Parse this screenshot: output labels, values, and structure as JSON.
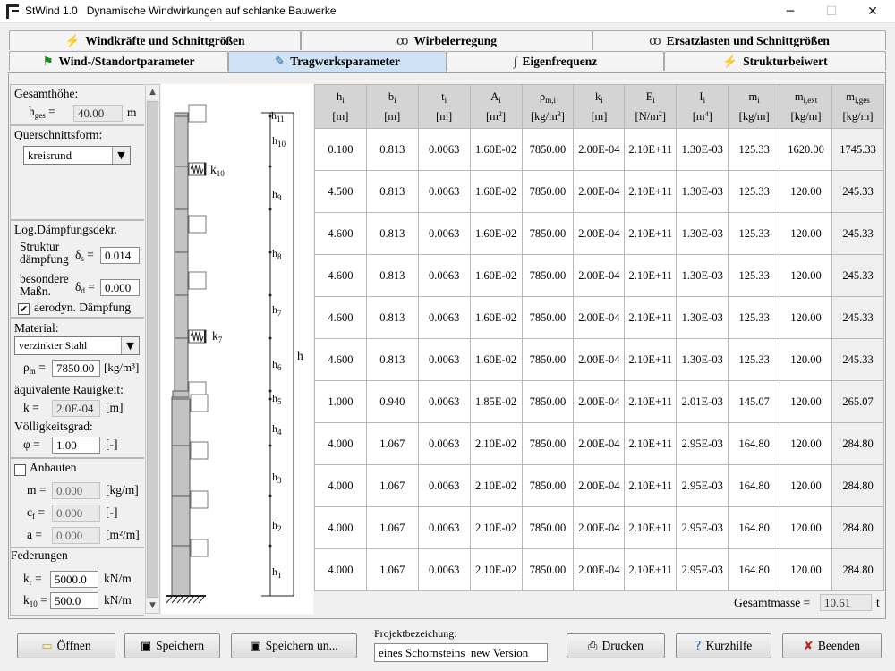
{
  "window": {
    "app_name": "StWind 1.0",
    "subtitle": "Dynamische Windwirkungen auf schlanke Bauwerke",
    "minimize": "─",
    "maximize": "☐",
    "close": "✕"
  },
  "tabs_top": [
    {
      "label": "Windkräfte und Schnittgrößen",
      "icon": "red-zigzag-icon"
    },
    {
      "label": "Wirbelerregung",
      "icon": "vortex-icon"
    },
    {
      "label": "Ersatzlasten und Schnittgrößen",
      "icon": "vortex-icon"
    }
  ],
  "tabs_bottom": [
    {
      "label": "Wind-/Standortparameter",
      "icon": "green-flag-icon"
    },
    {
      "label": "Tragwerksparameter",
      "icon": "edit-icon",
      "active": true
    },
    {
      "label": "Eigenfrequenz",
      "icon": "wave-icon"
    },
    {
      "label": "Strukturbeiwert",
      "icon": "red-zigzag-icon"
    }
  ],
  "left": {
    "gesamthoehe_label": "Gesamthöhe:",
    "hges_label": "h",
    "hges_sub": "ges",
    "hges_eq": "=",
    "hges_value": "40.00",
    "hges_unit": "m",
    "querschnitt_label": "Querschnittsform:",
    "querschnitt_value": "kreisrund",
    "daempfung_label": "Log.Dämpfungsdekr.",
    "struktur_label_1": "Struktur",
    "struktur_label_2": "dämpfung",
    "delta_s_label": "δ",
    "delta_s_sub": "s",
    "delta_s_eq": "=",
    "delta_s_value": "0.014",
    "besondere_label_1": "besondere",
    "besondere_label_2": "Maßn.",
    "delta_d_label": "δ",
    "delta_d_sub": "d",
    "delta_d_eq": "=",
    "delta_d_value": "0.000",
    "aerodyn_label": "aerodyn. Dämpfung",
    "aerodyn_checked": "✔",
    "material_label": "Material:",
    "material_value": "verzinkter Stahl",
    "rho_label": "ρ",
    "rho_sub": "m",
    "rho_eq": "=",
    "rho_value": "7850.00",
    "rho_unit": "[kg/m³]",
    "rauigkeit_label": "äquivalente Rauigkeit:",
    "k_label": "k =",
    "k_value": "2.0E-04",
    "k_unit": "[m]",
    "voelligkeit_label": "Völligkeitsgrad:",
    "phi_label": "φ =",
    "phi_value": "1.00",
    "phi_unit": "[-]",
    "anbauten_label": "Anbauten",
    "m_label": "m =",
    "m_value": "0.000",
    "m_unit": "[kg/m]",
    "cf_label": "c",
    "cf_sub": "f",
    "cf_eq": "=",
    "cf_value": "0.000",
    "cf_unit": "[-]",
    "a_label": "a =",
    "a_value": "0.000",
    "a_unit": "[m²/m]",
    "federungen_label": "Federungen",
    "kr_label": "k",
    "kr_sub": "r",
    "kr_eq": "=",
    "kr_value": "5000.0",
    "kr_unit": "kN/m",
    "k10_label": "k",
    "k10_sub": "10",
    "k10_eq": "=",
    "k10_value": "500.0",
    "k10_unit": "kN/m"
  },
  "drawing": {
    "spring_k10": "k",
    "spring_k10_sub": "10",
    "spring_k7": "k",
    "spring_k7_sub": "7",
    "total_height_label": "h",
    "segment_labels": [
      {
        "t": "h",
        "s": "11"
      },
      {
        "t": "h",
        "s": "10"
      },
      {
        "t": "h",
        "s": "9"
      },
      {
        "t": "h",
        "s": "8"
      },
      {
        "t": "h",
        "s": "7"
      },
      {
        "t": "h",
        "s": "6"
      },
      {
        "t": "h",
        "s": "5"
      },
      {
        "t": "h",
        "s": "4"
      },
      {
        "t": "h",
        "s": "3"
      },
      {
        "t": "h",
        "s": "2"
      },
      {
        "t": "h",
        "s": "1"
      }
    ]
  },
  "table": {
    "headers": [
      {
        "sym": "h",
        "sub": "i",
        "unit": "[m]",
        "unit_sup": ""
      },
      {
        "sym": "b",
        "sub": "i",
        "unit": "[m]",
        "unit_sup": ""
      },
      {
        "sym": "t",
        "sub": "i",
        "unit": "[m]",
        "unit_sup": ""
      },
      {
        "sym": "A",
        "sub": "i",
        "unit": "[m",
        "unit_sup": "2"
      },
      {
        "sym": "ρ",
        "sub": "m,i",
        "unit": "[kg/m",
        "unit_sup": "3"
      },
      {
        "sym": "k",
        "sub": "i",
        "unit": "[m]",
        "unit_sup": ""
      },
      {
        "sym": "E",
        "sub": "i",
        "unit": "[N/m",
        "unit_sup": "2"
      },
      {
        "sym": "I",
        "sub": "i",
        "unit": "[m",
        "unit_sup": "4"
      },
      {
        "sym": "m",
        "sub": "i",
        "unit": "[kg/m]",
        "unit_sup": ""
      },
      {
        "sym": "m",
        "sub": "i,ext",
        "unit": "[kg/m]",
        "unit_sup": ""
      },
      {
        "sym": "m",
        "sub": "i,ges",
        "unit": "[kg/m]",
        "unit_sup": ""
      }
    ],
    "rows": [
      [
        "0.100",
        "0.813",
        "0.0063",
        "1.60E-02",
        "7850.00",
        "2.00E-04",
        "2.10E+11",
        "1.30E-03",
        "125.33",
        "1620.00",
        "1745.33"
      ],
      [
        "4.500",
        "0.813",
        "0.0063",
        "1.60E-02",
        "7850.00",
        "2.00E-04",
        "2.10E+11",
        "1.30E-03",
        "125.33",
        "120.00",
        "245.33"
      ],
      [
        "4.600",
        "0.813",
        "0.0063",
        "1.60E-02",
        "7850.00",
        "2.00E-04",
        "2.10E+11",
        "1.30E-03",
        "125.33",
        "120.00",
        "245.33"
      ],
      [
        "4.600",
        "0.813",
        "0.0063",
        "1.60E-02",
        "7850.00",
        "2.00E-04",
        "2.10E+11",
        "1.30E-03",
        "125.33",
        "120.00",
        "245.33"
      ],
      [
        "4.600",
        "0.813",
        "0.0063",
        "1.60E-02",
        "7850.00",
        "2.00E-04",
        "2.10E+11",
        "1.30E-03",
        "125.33",
        "120.00",
        "245.33"
      ],
      [
        "4.600",
        "0.813",
        "0.0063",
        "1.60E-02",
        "7850.00",
        "2.00E-04",
        "2.10E+11",
        "1.30E-03",
        "125.33",
        "120.00",
        "245.33"
      ],
      [
        "1.000",
        "0.940",
        "0.0063",
        "1.85E-02",
        "7850.00",
        "2.00E-04",
        "2.10E+11",
        "2.01E-03",
        "145.07",
        "120.00",
        "265.07"
      ],
      [
        "4.000",
        "1.067",
        "0.0063",
        "2.10E-02",
        "7850.00",
        "2.00E-04",
        "2.10E+11",
        "2.95E-03",
        "164.80",
        "120.00",
        "284.80"
      ],
      [
        "4.000",
        "1.067",
        "0.0063",
        "2.10E-02",
        "7850.00",
        "2.00E-04",
        "2.10E+11",
        "2.95E-03",
        "164.80",
        "120.00",
        "284.80"
      ],
      [
        "4.000",
        "1.067",
        "0.0063",
        "2.10E-02",
        "7850.00",
        "2.00E-04",
        "2.10E+11",
        "2.95E-03",
        "164.80",
        "120.00",
        "284.80"
      ],
      [
        "4.000",
        "1.067",
        "0.0063",
        "2.10E-02",
        "7850.00",
        "2.00E-04",
        "2.10E+11",
        "2.95E-03",
        "164.80",
        "120.00",
        "284.80"
      ]
    ],
    "gesamtmasse_label": "Gesamtmasse =",
    "gesamtmasse_value": "10.61",
    "gesamtmasse_unit": "t"
  },
  "bottom": {
    "open": "Öffnen",
    "save": "Speichern",
    "save_as": "Speichern un...",
    "project_label": "Projektbezeichung:",
    "project_value": "eines Schornsteins_new Version",
    "print": "Drucken",
    "help": "Kurzhilfe",
    "quit": "Beenden"
  }
}
